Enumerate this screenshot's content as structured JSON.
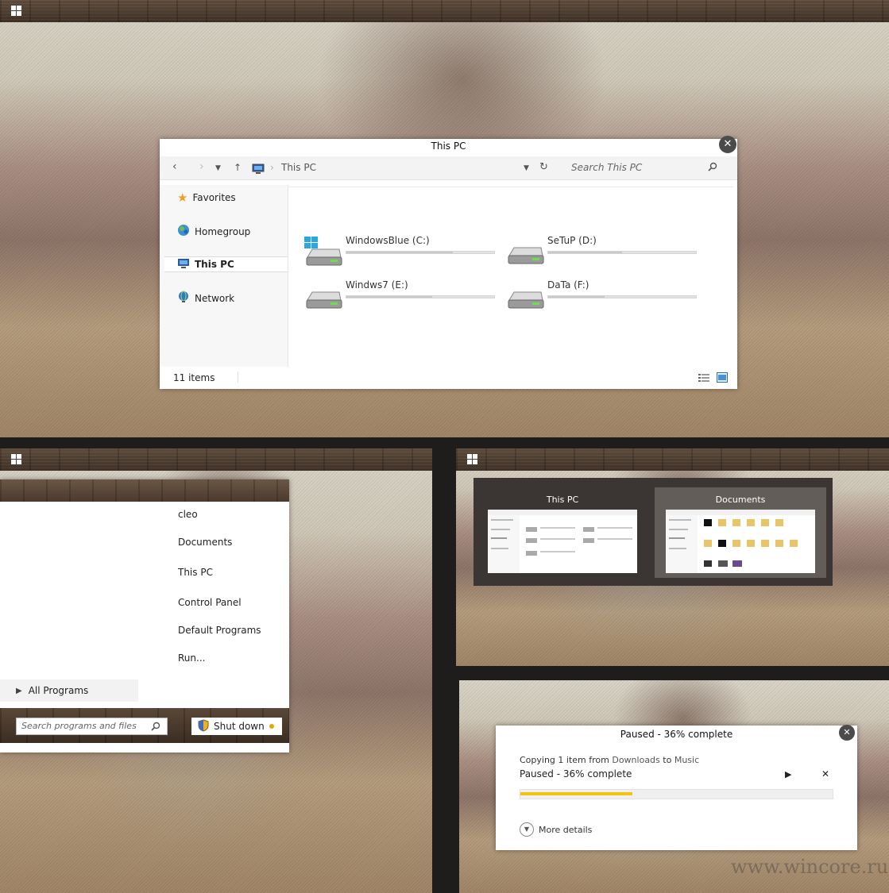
{
  "explorer": {
    "title": "This PC",
    "address": "This PC",
    "search_placeholder": "Search This PC",
    "sidebar": [
      {
        "label": "Favorites"
      },
      {
        "label": "Homegroup"
      },
      {
        "label": "This PC"
      },
      {
        "label": "Network"
      }
    ],
    "drives": [
      {
        "label": "WindowsBlue (C:)",
        "used_fraction": 0.72
      },
      {
        "label": "SeTuP (D:)",
        "used_fraction": 0.5
      },
      {
        "label": "Windws7 (E:)",
        "used_fraction": 0.58
      },
      {
        "label": "DaTa (F:)",
        "used_fraction": 0.38
      }
    ],
    "status": "11 items",
    "close_glyph": "✕"
  },
  "start_menu": {
    "links": [
      "cleo",
      "Documents",
      "This PC",
      "Control Panel",
      "Default Programs",
      "Run..."
    ],
    "all_programs": "All Programs",
    "search_placeholder": "Search programs and files",
    "shutdown_label": "Shut down"
  },
  "alt_tab": {
    "items": [
      {
        "title": "This PC"
      },
      {
        "title": "Documents"
      }
    ]
  },
  "copy_dialog": {
    "title": "Paused - 36% complete",
    "line1_prefix": "Copying 1 item from ",
    "line1_source": "Downloads",
    "line1_mid": " to ",
    "line1_dest": "Music",
    "status": "Paused - 36% complete",
    "progress": 0.36,
    "more_details": "More details",
    "play_glyph": "▶",
    "cancel_glyph": "✕",
    "close_glyph": "✕",
    "progress_color": "#f2c410"
  },
  "watermark": "www.wincore.ru",
  "colors": {
    "wood": "#4a3a2d",
    "accent_link": "#555555",
    "win_logo_blue": "#29a8e0"
  }
}
